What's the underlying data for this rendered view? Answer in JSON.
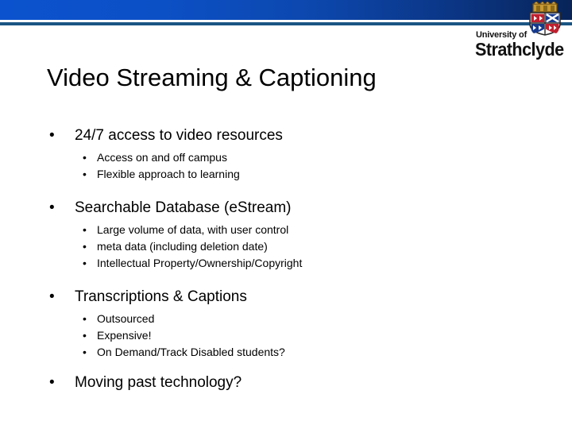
{
  "branding": {
    "logo_line1": "University of",
    "logo_line2": "Strathclyde",
    "shield_icon": "strathclyde-shield-icon",
    "band_color_left": "#0b52ce",
    "band_color_right": "#082458",
    "rule_color": "#1b5584"
  },
  "slide": {
    "title": "Video Streaming & Captioning",
    "bullet_marker": "•",
    "groups": [
      {
        "heading": "24/7 access to video resources",
        "subpoints": [
          "Access on and off campus",
          "Flexible approach to learning"
        ]
      },
      {
        "heading": "Searchable Database (eStream)",
        "subpoints": [
          "Large volume of data, with user control",
          "meta data (including deletion date)",
          "Intellectual Property/Ownership/Copyright"
        ]
      },
      {
        "heading": "Transcriptions & Captions",
        "subpoints": [
          "Outsourced",
          "Expensive!",
          "On Demand/Track Disabled students?"
        ]
      },
      {
        "heading": "Moving past technology?",
        "subpoints": []
      }
    ]
  }
}
